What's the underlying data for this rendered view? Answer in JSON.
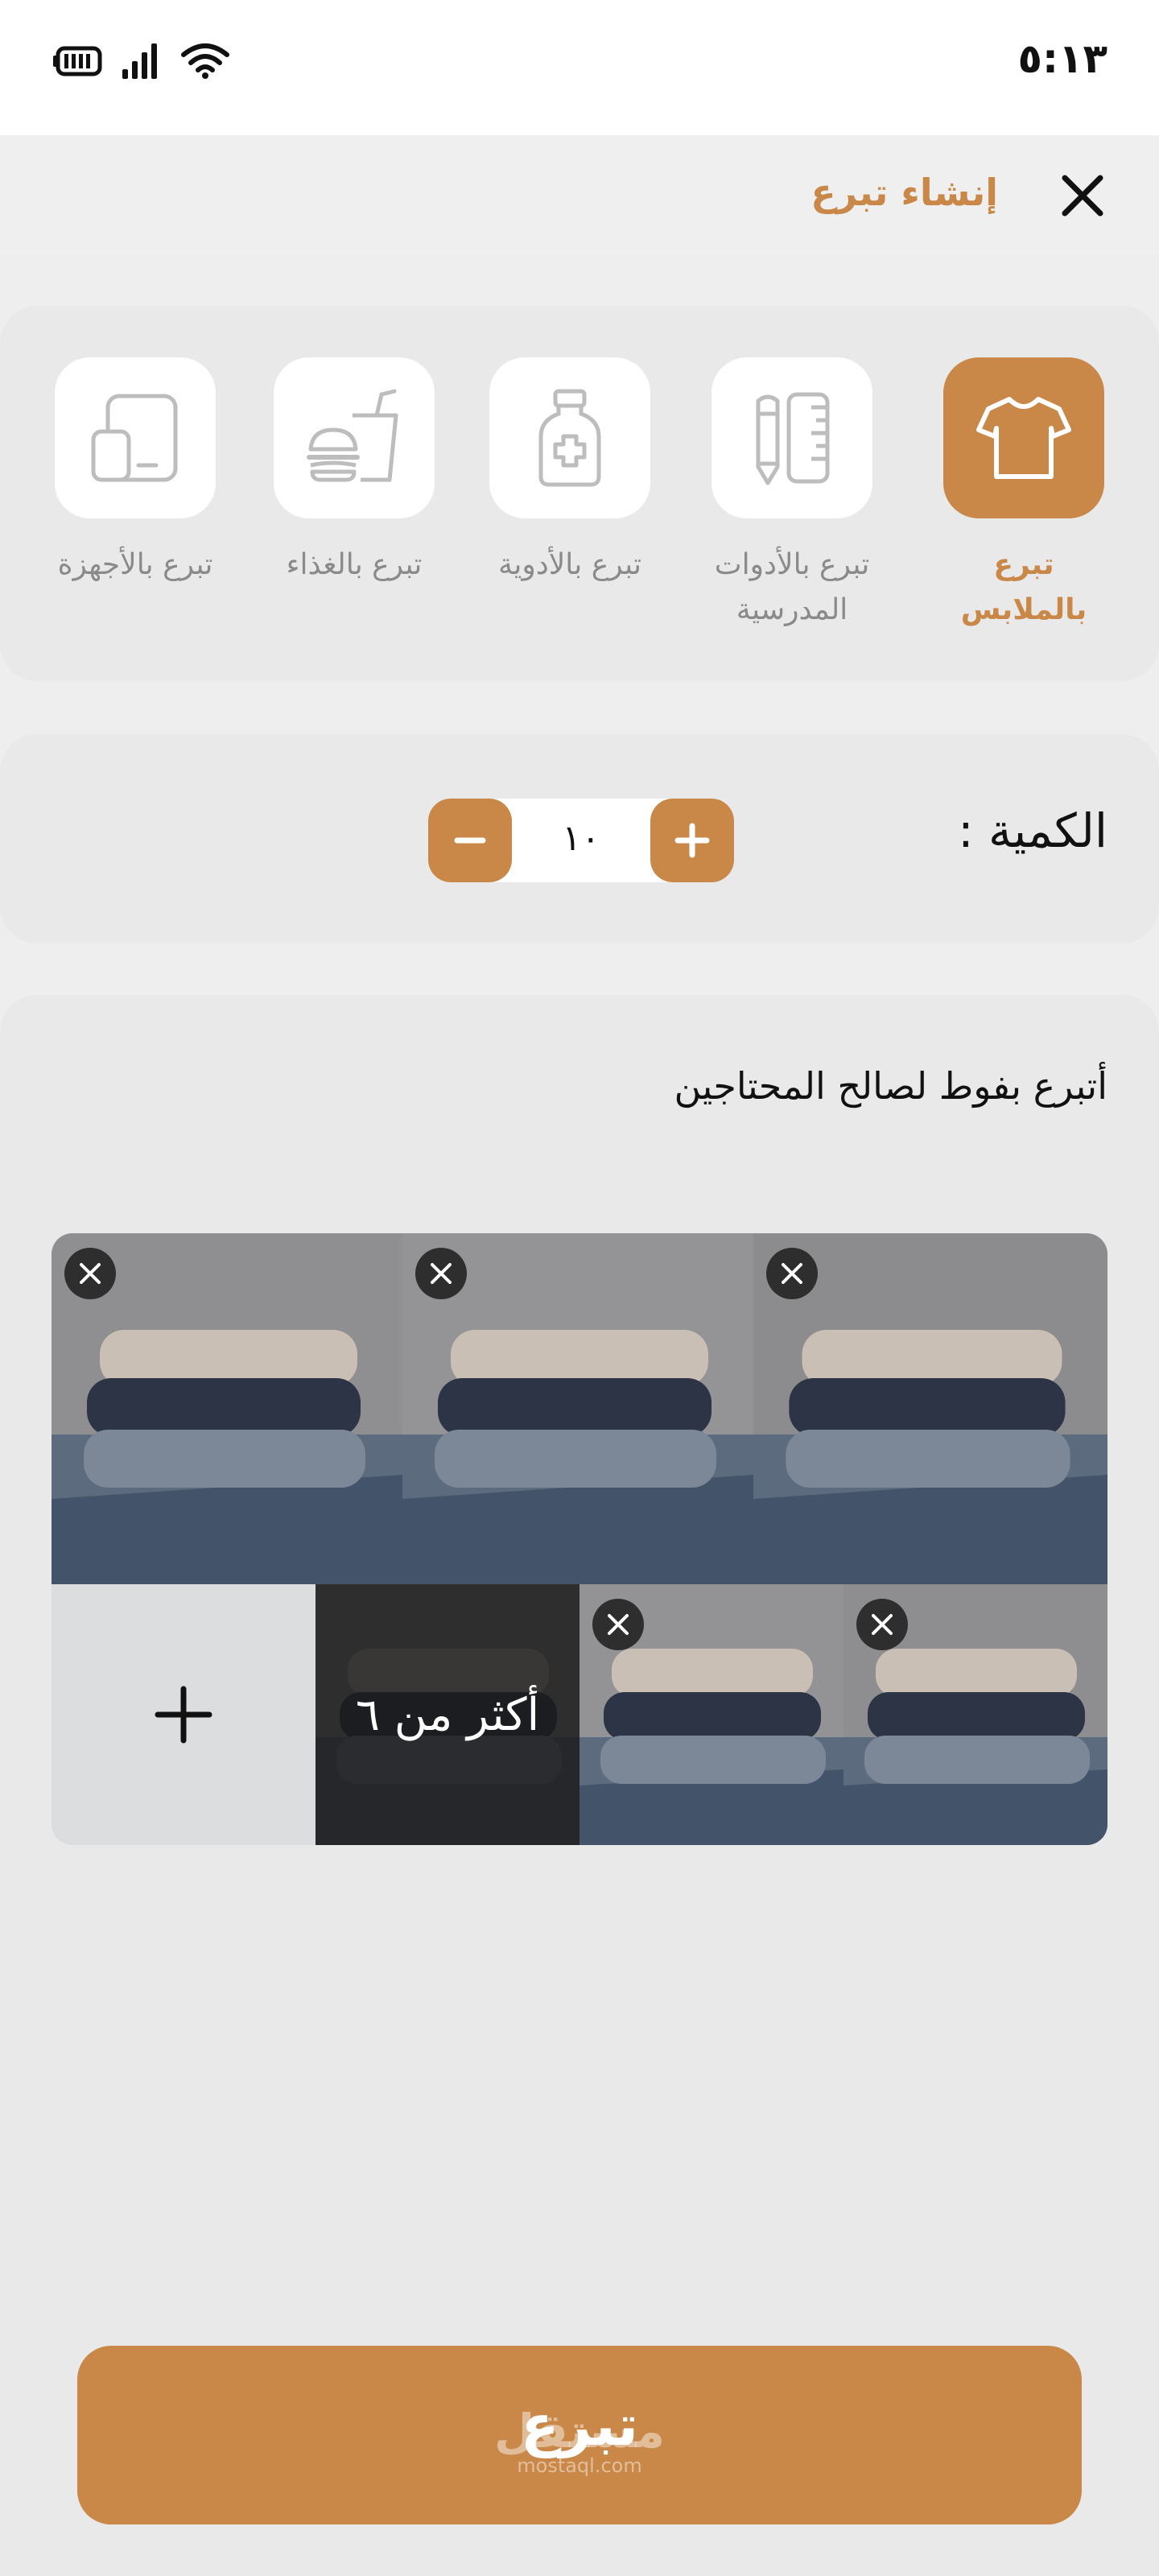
{
  "status_bar": {
    "time": "٥:١٣",
    "battery_icon": "battery-icon",
    "signal_icon": "signal-icon",
    "wifi_icon": "wifi-icon"
  },
  "header": {
    "title": "إنشاء تبرع",
    "close_icon": "close-icon"
  },
  "categories": [
    {
      "label": "تبرع بالملابس",
      "icon": "tshirt-icon",
      "active": true
    },
    {
      "label": "تبرع بالأدوات المدرسية",
      "icon": "school-tools-icon",
      "active": false
    },
    {
      "label": "تبرع بالأدوية",
      "icon": "medicine-bottle-icon",
      "active": false
    },
    {
      "label": "تبرع بالغذاء",
      "icon": "food-icon",
      "active": false
    },
    {
      "label": "تبرع بالأجهزة",
      "icon": "devices-icon",
      "active": false
    }
  ],
  "quantity": {
    "label": "الكمية :",
    "value": "١٠",
    "minus_icon": "minus-icon",
    "plus_icon": "plus-icon"
  },
  "description": "أتبرع بفوط لصالح المحتاجين",
  "photos": {
    "more_label": "أكثر من ٦",
    "remove_icon": "close-icon",
    "add_icon": "plus-icon"
  },
  "donate_button": {
    "label": "تبرع"
  },
  "watermark": {
    "arabic": "مستقل",
    "latin": "mostaql.com"
  },
  "colors": {
    "accent": "#c98848",
    "background": "#eeeeee",
    "card": "#e9e9e9"
  }
}
